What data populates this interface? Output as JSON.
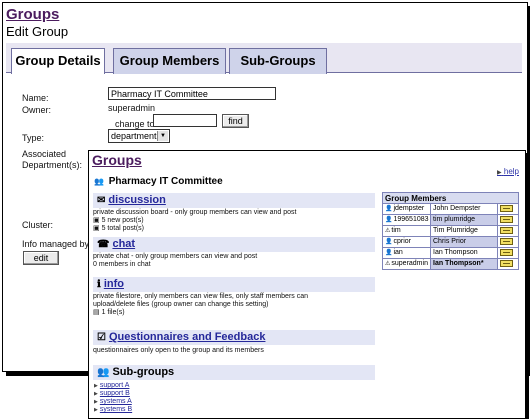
{
  "back": {
    "title": "Groups",
    "subtitle": "Edit Group",
    "tabs": [
      "Group Details",
      "Group Members",
      "Sub-Groups"
    ],
    "labels": {
      "name": "Name:",
      "owner": "Owner:",
      "change_to": "change to:",
      "type": "Type:",
      "assoc_line1": "Associated",
      "assoc_line2": "Department(s):",
      "cluster": "Cluster:",
      "info_by": "Info managed by:"
    },
    "name_value": "Pharmacy IT Committee",
    "owner_value": "superadmin",
    "type_value": "department",
    "find_label": "find",
    "edit_label": "edit"
  },
  "front": {
    "title": "Groups",
    "help_label": "help",
    "group_name": "Pharmacy IT Committee",
    "sections": {
      "discussion": {
        "title": "discussion",
        "icon": "discussion-icon",
        "desc": "private discussion board - only group members can view and post",
        "new_posts": "5 new post(s)",
        "total_posts": "5 total post(s)"
      },
      "chat": {
        "title": "chat",
        "icon": "chat-icon",
        "desc": "private chat - only group members can view and post",
        "members": "0 members in chat"
      },
      "info": {
        "title": "info",
        "icon": "info-icon",
        "desc1": "private filestore, only members can view files, only staff members can",
        "desc2": "upload/delete files (group owner can change this setting)",
        "files": "1 file(s)"
      },
      "questionnaires": {
        "title": "Questionnaires and Feedback",
        "icon": "questionnaire-icon",
        "desc": "questionnaires only open to the group and its members"
      },
      "subgroups": {
        "title": "Sub-groups",
        "icon": "subgroups-icon",
        "items": [
          "support A",
          "support B",
          "systems A",
          "systems B"
        ]
      }
    },
    "members": {
      "title": "Group Members",
      "rows": [
        {
          "id": "jdempster",
          "name": "John Dempster",
          "icon": "user-icon"
        },
        {
          "id": "199651083",
          "name": "tim plumridge",
          "icon": "user-icon"
        },
        {
          "id": "tim",
          "name": "Tim Plumridge",
          "icon": "user-warning-icon"
        },
        {
          "id": "cprior",
          "name": "Chris Prior",
          "icon": "user-icon"
        },
        {
          "id": "ian",
          "name": "Ian Thompson",
          "icon": "user-icon"
        },
        {
          "id": "superadmin",
          "name": "Ian Thompson*",
          "icon": "user-warning-icon"
        }
      ]
    }
  }
}
